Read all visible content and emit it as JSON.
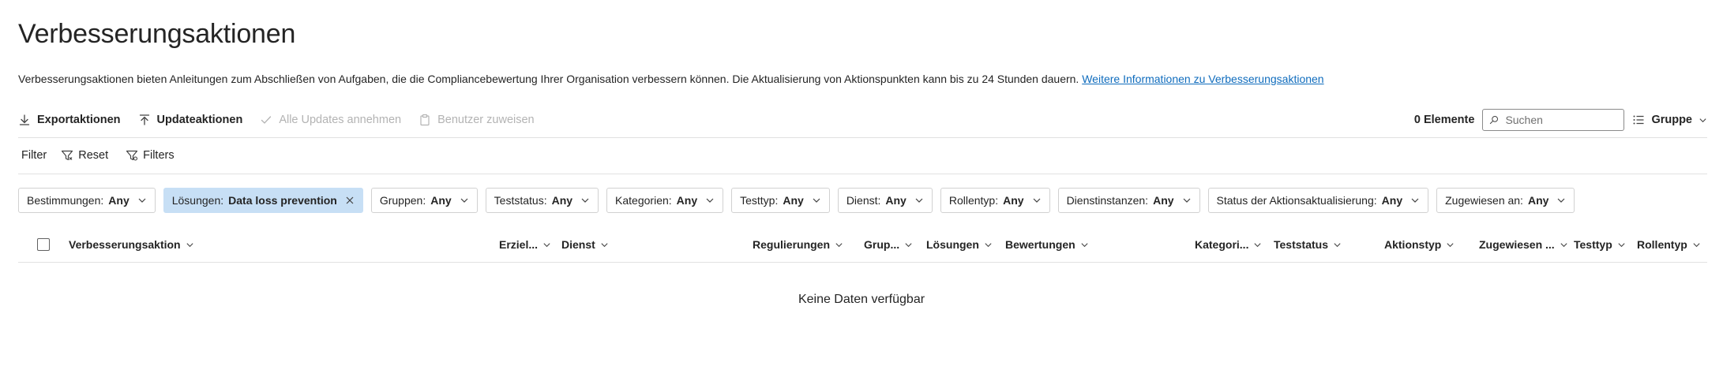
{
  "page": {
    "title": "Verbesserungsaktionen",
    "description": "Verbesserungsaktionen bieten Anleitungen zum Abschließen von Aufgaben, die die Compliancebewertung Ihrer Organisation verbessern können. Die Aktualisierung von Aktionspunkten kann bis zu 24 Stunden dauern.",
    "link_text": "Weitere Informationen zu Verbesserungsaktionen"
  },
  "toolbar": {
    "export_label": "Exportaktionen",
    "update_label": "Updateaktionen",
    "accept_all_label": "Alle Updates annehmen",
    "assign_users_label": "Benutzer zuweisen",
    "count_label": "0 Elemente",
    "search_placeholder": "Suchen",
    "group_label": "Gruppe"
  },
  "filterbar": {
    "label": "Filter",
    "reset_label": "Reset",
    "filters_label": "Filters"
  },
  "chips": [
    {
      "name": "Bestimmungen:",
      "value": "Any",
      "active": false
    },
    {
      "name": "Lösungen:",
      "value": "Data loss prevention",
      "active": true
    },
    {
      "name": "Gruppen:",
      "value": "Any",
      "active": false
    },
    {
      "name": "Teststatus:",
      "value": "Any",
      "active": false
    },
    {
      "name": "Kategorien:",
      "value": "Any",
      "active": false
    },
    {
      "name": "Testtyp:",
      "value": "Any",
      "active": false
    },
    {
      "name": "Dienst:",
      "value": "Any",
      "active": false
    },
    {
      "name": "Rollentyp:",
      "value": "Any",
      "active": false
    },
    {
      "name": "Dienstinstanzen:",
      "value": "Any",
      "active": false
    },
    {
      "name": "Status der Aktionsaktualisierung:",
      "value": "Any",
      "active": false
    },
    {
      "name": "Zugewiesen an:",
      "value": "Any",
      "active": false
    }
  ],
  "table": {
    "columns": [
      "Verbesserungsaktion",
      "Erziel...",
      "Dienst",
      "Regulierungen",
      "Grup...",
      "Lösungen",
      "Bewertungen",
      "Kategori...",
      "Teststatus",
      "Aktionstyp",
      "Zugewiesen ...",
      "Testtyp",
      "Rollentyp"
    ],
    "empty_text": "Keine Daten verfügbar"
  }
}
